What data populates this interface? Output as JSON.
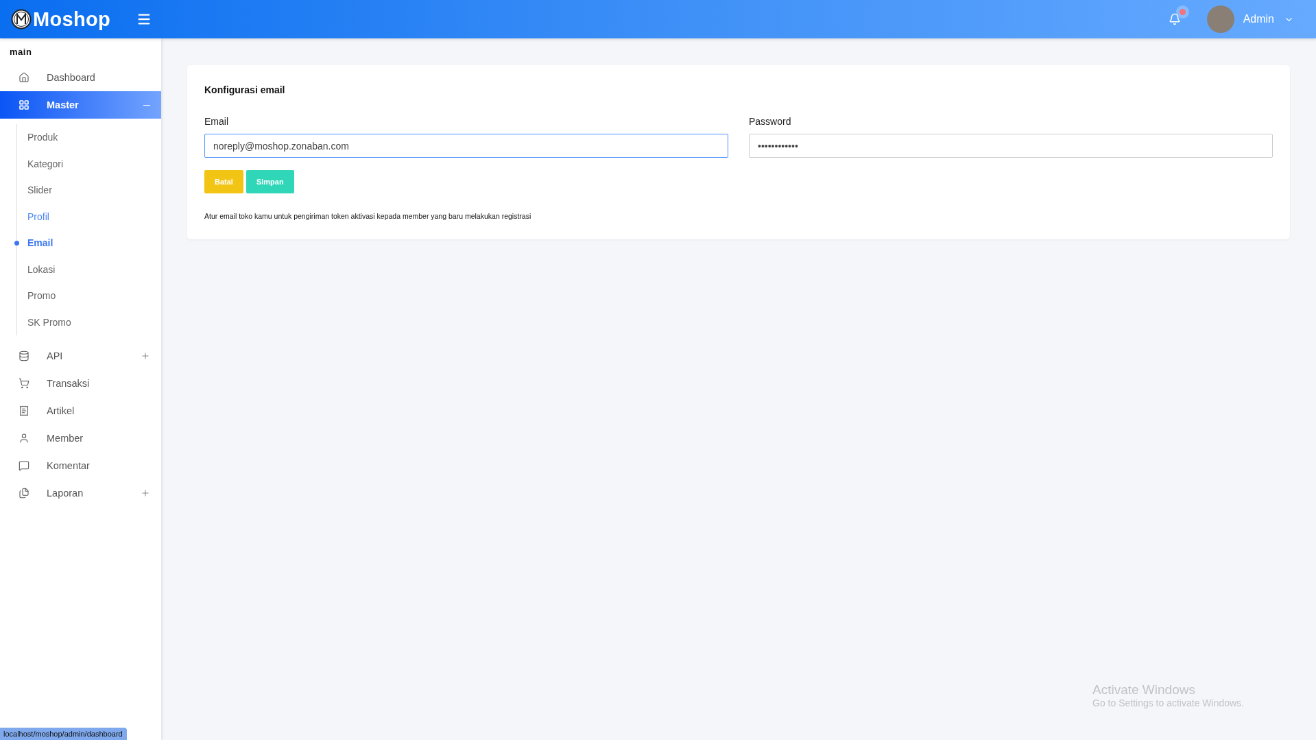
{
  "header": {
    "logo_text": "Moshop",
    "notification_badge": true,
    "user_name": "Admin"
  },
  "sidebar": {
    "section_title": "main",
    "items": [
      {
        "kind": "link",
        "label": "Dashboard"
      },
      {
        "kind": "group",
        "label": "Master",
        "selected": true,
        "expanded": true,
        "children": [
          {
            "label": "Produk",
            "selected": false,
            "highlighted": false
          },
          {
            "label": "Kategori",
            "selected": false,
            "highlighted": false
          },
          {
            "label": "Slider",
            "selected": false,
            "highlighted": false
          },
          {
            "label": "Profil",
            "selected": false,
            "highlighted": true
          },
          {
            "label": "Email",
            "selected": true,
            "highlighted": false
          },
          {
            "label": "Lokasi",
            "selected": false,
            "highlighted": false
          },
          {
            "label": "Promo",
            "selected": false,
            "highlighted": false
          },
          {
            "label": "SK Promo",
            "selected": false,
            "highlighted": false
          }
        ]
      },
      {
        "kind": "group",
        "label": "API",
        "selected": false,
        "expanded": false
      },
      {
        "kind": "link",
        "label": "Transaksi"
      },
      {
        "kind": "link",
        "label": "Artikel"
      },
      {
        "kind": "link",
        "label": "Member"
      },
      {
        "kind": "link",
        "label": "Komentar"
      },
      {
        "kind": "group",
        "label": "Laporan",
        "selected": false,
        "expanded": false
      }
    ]
  },
  "card": {
    "title": "Konfigurasi email",
    "fields": [
      {
        "label": "Email",
        "value": "noreply@moshop.zonaban.com",
        "focused": true
      },
      {
        "label": "Password",
        "value": "••••••••••••",
        "focused": false
      }
    ],
    "buttons": [
      {
        "kind": "cancel",
        "label": "Batal"
      },
      {
        "kind": "save",
        "label": "Simpan"
      }
    ],
    "help_text": "Atur email toko kamu untuk pengiriman token aktivasi kepada member yang baru melakukan registrasi"
  },
  "status_url": "localhost/moshop/admin/dashboard",
  "os_notice": {
    "title": "Activate Windows",
    "subtitle": "Go to Settings to activate Windows."
  }
}
